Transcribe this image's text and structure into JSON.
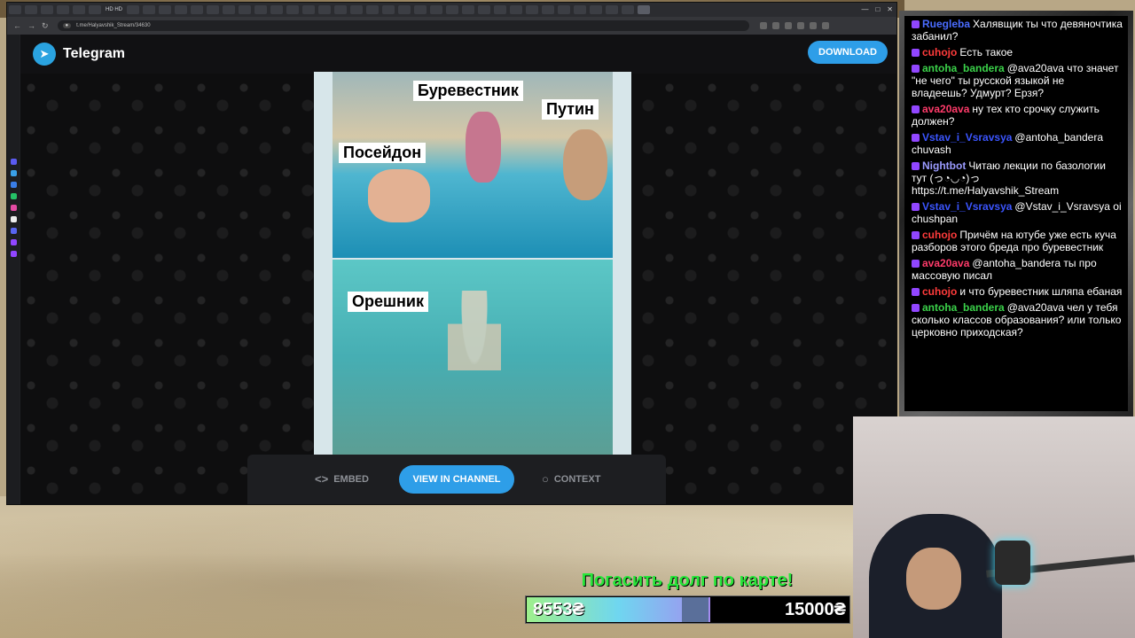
{
  "browser": {
    "url": "t.me/Halyavshik_Stream/34630",
    "tab_label": "HD HD"
  },
  "telegram": {
    "title": "Telegram",
    "download_label": "DOWNLOAD",
    "meme_labels": {
      "burevestnik": "Буревестник",
      "putin": "Путин",
      "poseidon": "Посейдон",
      "oreshnik": "Орешник"
    },
    "actions": {
      "embed": "EMBED",
      "view_in_channel": "VIEW IN CHANNEL",
      "context": "CONTEXT"
    }
  },
  "chat": {
    "messages": [
      {
        "user": "Ruegleba",
        "color": "#4a6cff",
        "text": "Халявщик ты что девяночтика забанил?"
      },
      {
        "user": "cuhojo",
        "color": "#ff3b3b",
        "text": "Есть такое"
      },
      {
        "user": "antoha_bandera",
        "color": "#3bd24a",
        "text": "@ava20ava что значет \"не чего\" ты русской языкой не владеешь? Удмурт? Ерзя?"
      },
      {
        "user": "ava20ava",
        "color": "#ff3b6a",
        "text": "ну тех кто срочку служить должен?"
      },
      {
        "user": "Vstav_i_Vsravsya",
        "color": "#3b55ff",
        "text": "@antoha_bandera chuvash"
      },
      {
        "user": "Nightbot",
        "color": "#9b9bff",
        "text": "Читаю лекции по базологии тут (っ◔◡◔)っ https://t.me/Halyavshik_Stream"
      },
      {
        "user": "Vstav_i_Vsravsya",
        "color": "#3b55ff",
        "text": "@Vstav_i_Vsravsya oi chushpan"
      },
      {
        "user": "cuhojo",
        "color": "#ff3b3b",
        "text": "Причём на ютубе уже есть куча разборов этого бреда про буревестник"
      },
      {
        "user": "ava20ava",
        "color": "#ff3b6a",
        "text": "@antoha_bandera ты про массовую писал"
      },
      {
        "user": "cuhojo",
        "color": "#ff3b3b",
        "text": "и что буревестник шляпа ебаная"
      },
      {
        "user": "antoha_bandera",
        "color": "#3bd24a",
        "text": "@ava20ava чел у тебя сколько классов образования? или только церковно приходская?"
      }
    ]
  },
  "goal": {
    "title": "Погасить долг по карте!",
    "current": "8553₴",
    "target": "15000₴",
    "progress": 0.5702
  }
}
